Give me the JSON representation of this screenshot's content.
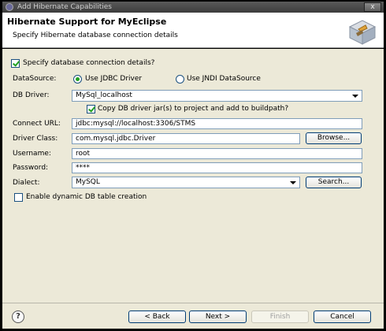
{
  "window": {
    "title": "Add Hibernate Capabilities",
    "close_glyph": "x"
  },
  "header": {
    "title": "Hibernate Support for MyEclipse",
    "description": "Specify Hibernate database connection details"
  },
  "form": {
    "specify_details": {
      "label": "Specify database connection details?",
      "checked": true
    },
    "datasource": {
      "label": "DataSource:",
      "option_jdbc": "Use JDBC Driver",
      "option_jndi": "Use JNDI DataSource",
      "selected": "Use JDBC Driver"
    },
    "db_driver": {
      "label": "DB Driver:",
      "value": "MySql_localhost"
    },
    "copy_driver": {
      "label": "Copy DB driver jar(s) to project and add to buildpath?",
      "checked": true
    },
    "connect_url": {
      "label": "Connect URL:",
      "value": "jdbc:mysql://localhost:3306/STMS"
    },
    "driver_class": {
      "label": "Driver Class:",
      "value": "com.mysql.jdbc.Driver",
      "browse_label": "Browse..."
    },
    "username": {
      "label": "Username:",
      "value": "root"
    },
    "password": {
      "label": "Password:",
      "value": "****"
    },
    "dialect": {
      "label": "Dialect:",
      "value": "MySQL",
      "search_label": "Search..."
    },
    "dynamic_table": {
      "label": "Enable dynamic DB table creation",
      "checked": false
    }
  },
  "footer": {
    "help_glyph": "?",
    "back_label": "< Back",
    "next_label": "Next >",
    "finish_label": "Finish",
    "cancel_label": "Cancel"
  }
}
